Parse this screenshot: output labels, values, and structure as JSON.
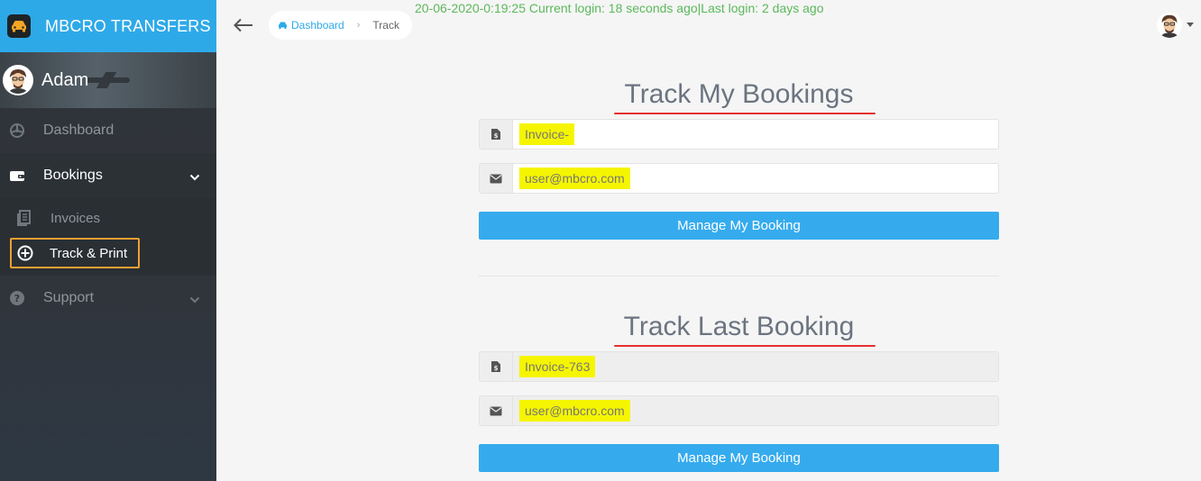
{
  "app": {
    "title": "MBCRO TRANSFERS"
  },
  "user": {
    "name": "Adam"
  },
  "sidebar": {
    "items": [
      {
        "label": "Dashboard",
        "icon": "steering-wheel-icon"
      },
      {
        "label": "Bookings",
        "icon": "wallet-icon"
      },
      {
        "label": "Support",
        "icon": "question-circle-icon"
      }
    ],
    "subitems": [
      {
        "label": "Invoices",
        "icon": "file-icon"
      },
      {
        "label": "Track & Print",
        "icon": "plus-circle-icon"
      }
    ]
  },
  "breadcrumb": {
    "home": "Dashboard",
    "current": "Track"
  },
  "login_info": "20-06-2020-0:19:25 Current login: 18 seconds ago|Last login: 2 days ago",
  "track_my": {
    "title": "Track My Bookings",
    "invoice_value": "Invoice-",
    "email_value": "user@mbcro.com",
    "button": "Manage My Booking"
  },
  "track_last": {
    "title": "Track Last Booking",
    "invoice_value": "Invoice-763",
    "email_value": "user@mbcro.com",
    "button": "Manage My Booking"
  },
  "colors": {
    "brand": "#2ea9e8",
    "button": "#35abee",
    "login_text": "#5cb85c",
    "highlight": "#f5f500",
    "underline": "#e53030",
    "active_outline": "#f0a030"
  }
}
